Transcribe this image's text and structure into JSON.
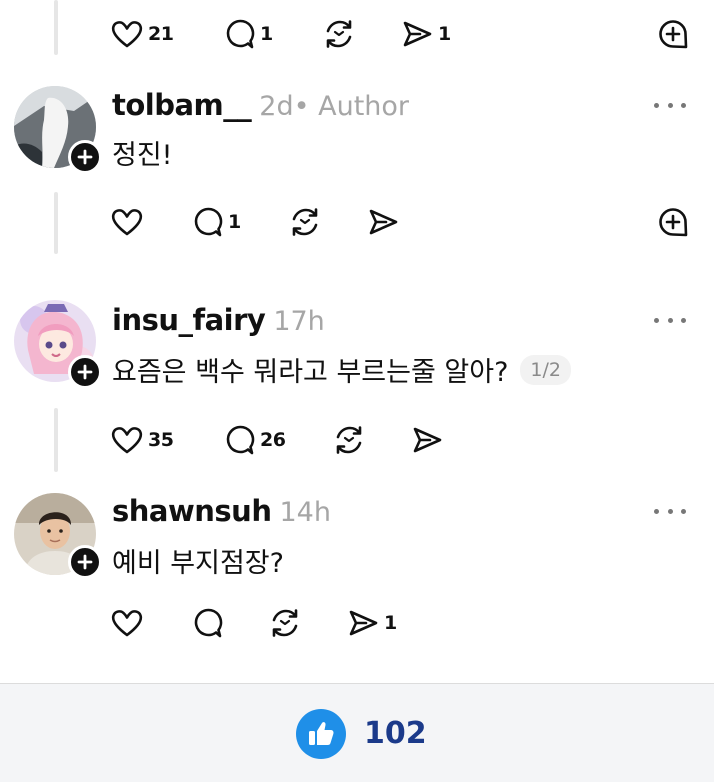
{
  "top_post_actions": {
    "likes": "21",
    "replies": "1",
    "reposts": "",
    "shares": "1"
  },
  "posts": [
    {
      "username": "tolbam__",
      "time": "2d",
      "author_tag": " • Author",
      "text": "정진!",
      "page_badge": "",
      "actions": {
        "likes": "",
        "replies": "1",
        "reposts": "",
        "shares": ""
      }
    },
    {
      "username": "insu_fairy",
      "time": "17h",
      "author_tag": "",
      "text": "요즘은 백수 뭐라고 부르는줄 알아?",
      "page_badge": "1/2",
      "actions": {
        "likes": "35",
        "replies": "26",
        "reposts": "",
        "shares": ""
      }
    },
    {
      "username": "shawnsuh",
      "time": "14h",
      "author_tag": "",
      "text": "예비 부지점장?",
      "page_badge": "",
      "actions": {
        "likes": "",
        "replies": "",
        "reposts": "",
        "shares": "1"
      }
    }
  ],
  "bottom_bar": {
    "like_count": "102"
  },
  "colors": {
    "accent": "#1f8fe8",
    "like_count": "#1b3a8a",
    "muted": "#a6a6a6",
    "thread_line": "#e6e6e6"
  },
  "icons": [
    "heart-icon",
    "reply-icon",
    "repost-icon",
    "share-icon",
    "quote-icon",
    "more-icon",
    "plus-icon",
    "thumbs-up-icon"
  ]
}
